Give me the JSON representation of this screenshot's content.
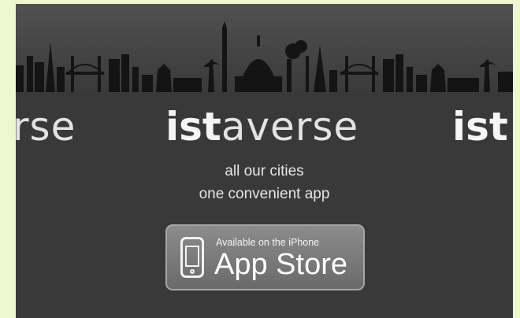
{
  "logo": {
    "bold": "ist",
    "light": "averse",
    "left_fragment": "rse",
    "right_fragment": "ist"
  },
  "tagline": {
    "line1": "all our cities",
    "line2": "one convenient app"
  },
  "badge": {
    "small_text": "Available on the iPhone",
    "big_text": "App Store",
    "icon": "iphone-icon"
  },
  "colors": {
    "page_background": "#eef7cf",
    "banner_background": "#393939",
    "skyline": "#111111",
    "badge_background": "#7a7a7a"
  }
}
